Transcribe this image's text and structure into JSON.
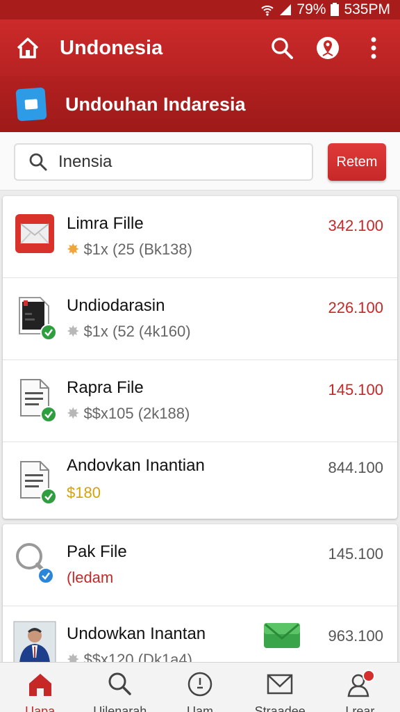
{
  "status": {
    "battery": "79%",
    "time": "535PM"
  },
  "appbar": {
    "title": "Undonesia"
  },
  "subbar": {
    "title": "Undouhan Indaresia"
  },
  "search": {
    "value": "Inensia",
    "button_label": "Retem"
  },
  "files_group1": [
    {
      "name": "Limra Fille",
      "meta": "$1x (25 (Bk138)",
      "value": "342.100",
      "value_color": "#c62828",
      "icon": "mail-icon"
    },
    {
      "name": "Undiodarasin",
      "meta": "$1x (52 (4k160)",
      "value": "226.100",
      "value_color": "#c62828",
      "icon": "dark-document-icon"
    },
    {
      "name": "Rapra File",
      "meta": "$$x105 (2k188)",
      "value": "145.100",
      "value_color": "#c62828",
      "icon": "document-icon"
    },
    {
      "name": "Andovkan Inantian",
      "meta": "$180",
      "value": "844.100",
      "value_color": "#555555",
      "icon": "document-icon"
    }
  ],
  "files_group2": [
    {
      "name": "Pak File",
      "meta": "(ledam",
      "value": "145.100",
      "icon": "magnifier-icon"
    },
    {
      "name": "Undowkan Inantan",
      "meta": "$$x120 (Dk1a4)",
      "value": "963.100",
      "icon": "photo-thumbnail"
    }
  ],
  "bottom_nav": [
    {
      "label": "Uapa",
      "icon": "home-icon"
    },
    {
      "label": "Uilenarah",
      "icon": "search-icon"
    },
    {
      "label": "Uam",
      "icon": "clock-icon"
    },
    {
      "label": "Straadee",
      "icon": "mail-icon"
    },
    {
      "label": "Lrear",
      "icon": "profile-icon"
    }
  ],
  "colors": {
    "primary": "#c62828",
    "dark_primary": "#a81c1c",
    "accent_blue": "#2d9be6",
    "success": "#2e9e3e"
  }
}
